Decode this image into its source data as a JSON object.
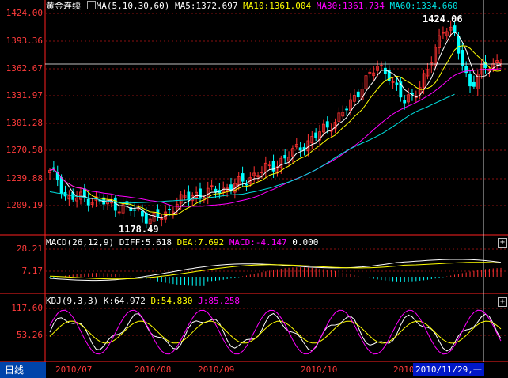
{
  "header": {
    "title": "黄金连续",
    "ma_label": "MA(5,10,30,60)",
    "ma5": "MA5:1372.697",
    "ma10": "MA10:1361.004",
    "ma30": "MA30:1361.734",
    "ma60": "MA60:1334.660"
  },
  "macd": {
    "label": "MACD(26,12,9)",
    "diff": "DIFF:5.618",
    "dea": "DEA:7.692",
    "macd": "MACD:-4.147",
    "zero": "0.000",
    "ticks": [
      "28.21",
      "7.17"
    ]
  },
  "kdj": {
    "label": "KDJ(9,3,3)",
    "k": "K:64.972",
    "d": "D:54.830",
    "j": "J:85.258",
    "ticks": [
      "117.60",
      "53.26"
    ]
  },
  "price": {
    "ticks": [
      "1424.00",
      "1393.36",
      "1362.67",
      "1331.97",
      "1301.28",
      "1270.58",
      "1239.88",
      "1209.19"
    ],
    "high_label": "1424.06",
    "low_label": "1178.49"
  },
  "xaxis": {
    "months": [
      "2010/07",
      "2010/08",
      "2010/09",
      "2010/10",
      "2010/"
    ]
  },
  "footer": {
    "tab": "日线",
    "cursor_date": "2010/11/29,一"
  },
  "colors": {
    "up": "#ff3232",
    "down": "#00ffff",
    "ma5": "#ffffff",
    "ma10": "#ffff00",
    "ma30": "#ff00ff",
    "ma60": "#00e0e0",
    "axis": "#ff2020"
  }
}
